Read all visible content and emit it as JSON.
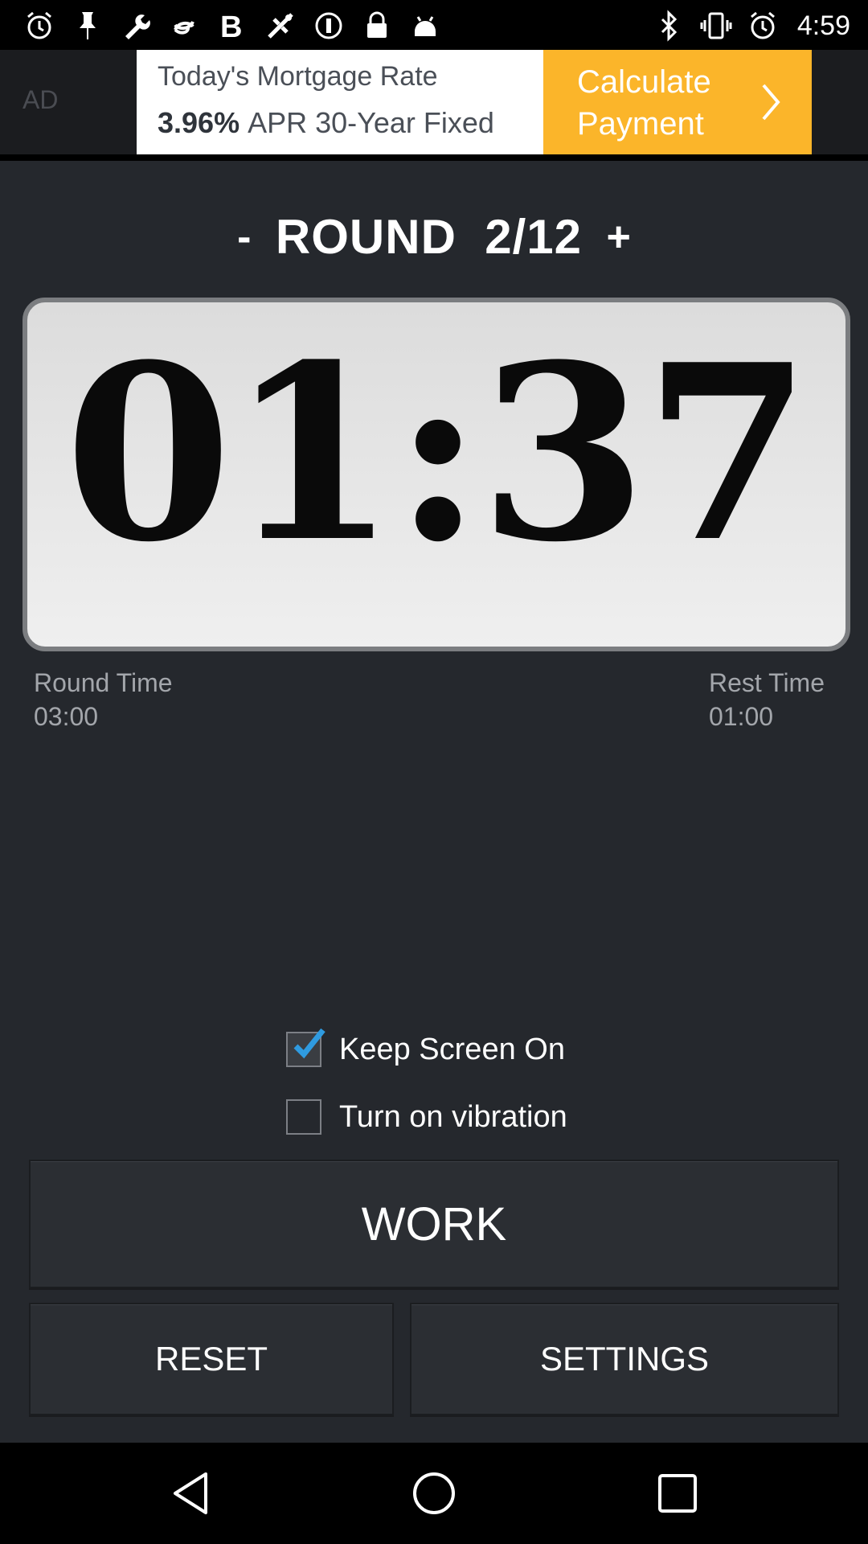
{
  "status_bar": {
    "time": "4:59",
    "left_icons": [
      "alarm-icon",
      "pin-icon",
      "wrench-icon",
      "swirl-icon",
      "bold-b-icon",
      "fake-gps-icon",
      "dollar-circle-icon",
      "lock-icon",
      "android-icon"
    ],
    "right_icons": [
      "bluetooth-icon",
      "vibrate-icon",
      "alarm-icon"
    ]
  },
  "ad": {
    "label": "AD",
    "line1": "Today's Mortgage Rate",
    "rate": "3.96%",
    "line2": "APR 30-Year Fixed",
    "cta": "Calculate Payment",
    "colors": {
      "cta_bg": "#fbb52a",
      "text": "#4a4f57"
    }
  },
  "round": {
    "minus": "-",
    "title": "ROUND  2/12",
    "plus": "+"
  },
  "timer": {
    "display": "01:37"
  },
  "round_time": {
    "label": "Round Time",
    "value": "03:00"
  },
  "rest_time": {
    "label": "Rest Time",
    "value": "01:00"
  },
  "options": {
    "keep_screen_on": {
      "label": "Keep Screen On",
      "checked": true
    },
    "vibration": {
      "label": "Turn on vibration",
      "checked": false
    }
  },
  "buttons": {
    "work": "WORK",
    "reset": "RESET",
    "settings": "SETTINGS"
  },
  "nav": {
    "icons": [
      "back-icon",
      "home-icon",
      "recents-icon"
    ]
  },
  "colors": {
    "background": "#25282d",
    "accent_check": "#2f9be0"
  }
}
